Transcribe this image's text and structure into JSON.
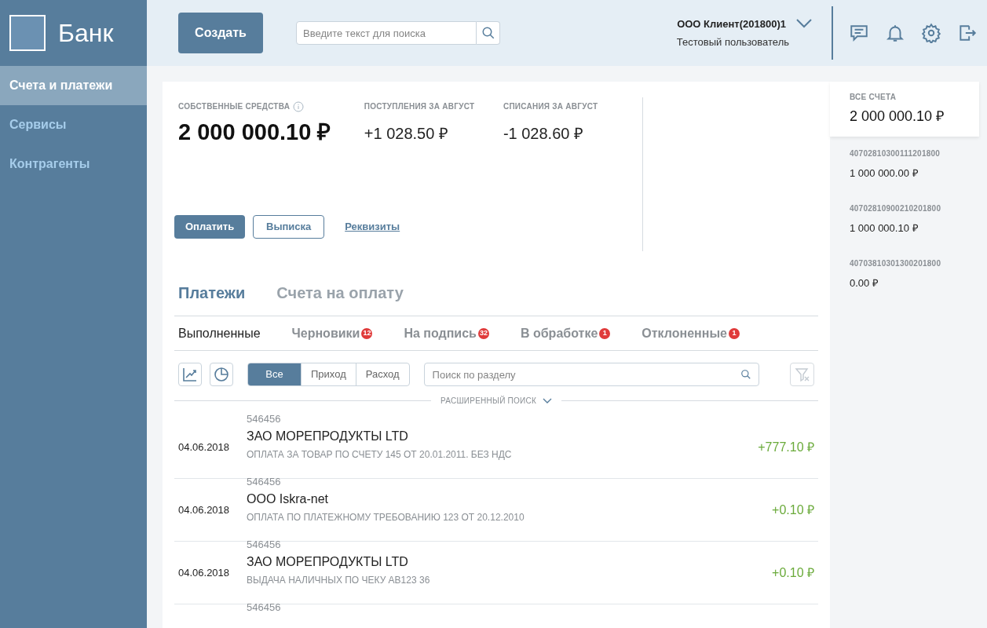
{
  "logo": {
    "text": "Банк"
  },
  "sidebar": {
    "items": [
      {
        "label": "Счета и платежи",
        "selected": true
      },
      {
        "label": "Сервисы",
        "selected": false
      },
      {
        "label": "Контрагенты",
        "selected": false
      }
    ]
  },
  "header": {
    "create_button": "Создать",
    "search": {
      "placeholder": "Введите текст для поиска"
    },
    "client": {
      "name": "ООО Клиент(201800)1",
      "user": "Тестовый пользователь"
    }
  },
  "summary": {
    "items": [
      {
        "label": "СОБСТВЕННЫЕ СРЕДСТВА",
        "value": "2 000 000.10 ₽",
        "kind": "main"
      },
      {
        "label": "ПОСТУПЛЕНИЯ ЗА АВГУСТ",
        "value": "+1 028.50 ₽",
        "kind": "plain"
      },
      {
        "label": "СПИСАНИЯ ЗА АВГУСТ",
        "value": "-1 028.60 ₽",
        "kind": "plain"
      }
    ],
    "buttons": {
      "pay": "Оплатить",
      "statement": "Выписка",
      "details": "Реквизиты"
    }
  },
  "tabs": [
    {
      "label": "Платежи",
      "selected": true
    },
    {
      "label": "Счета на оплату",
      "selected": false
    }
  ],
  "subtabs": [
    {
      "label": "Выполненные",
      "selected": true
    },
    {
      "label": "Черновики",
      "badge": "12",
      "selected": false
    },
    {
      "label": "На подпись",
      "badge": "32",
      "selected": false
    },
    {
      "label": "В обработке",
      "badge": "1",
      "selected": false
    },
    {
      "label": "Отклоненные",
      "badge": "1",
      "selected": false
    }
  ],
  "filter": {
    "segments": [
      {
        "label": "Все",
        "selected": true
      },
      {
        "label": "Приход",
        "selected": false
      },
      {
        "label": "Расход",
        "selected": false
      }
    ],
    "search_placeholder": "Поиск по разделу",
    "advanced": "РАСШИРЕННЫЙ ПОИСК"
  },
  "payments": [
    {
      "date": "04.06.2018",
      "code": "546456",
      "name": "ЗАО МОРЕПРОДУКТЫ LTD",
      "purpose": "ОПЛАТА ЗА ТОВАР ПО СЧЕТУ 145 ОТ 20.01.2011. БЕЗ НДС",
      "amount": "+777.10 ₽"
    },
    {
      "date": "04.06.2018",
      "code": "546456",
      "name": "ООО Iskra-net",
      "purpose": "ОПЛАТА ПО ПЛАТЕЖНОМУ ТРЕБОВАНИЮ 123 ОТ 20.12.2010",
      "amount": "+0.10 ₽"
    },
    {
      "date": "04.06.2018",
      "code": "546456",
      "name": "ЗАО МОРЕПРОДУКТЫ LTD",
      "purpose": "ВЫДАЧА НАЛИЧНЫХ ПО ЧЕКУ АВ123 36",
      "amount": "+0.10 ₽"
    },
    {
      "code": "546456"
    }
  ],
  "accounts": {
    "total_label": "ВСЕ СЧЕТА",
    "total": "2 000 000.10 ₽",
    "items": [
      {
        "number": "40702810300111201800",
        "balance": "1 000 000.00 ₽"
      },
      {
        "number": "40702810900210201800",
        "balance": "1 000 000.10 ₽"
      },
      {
        "number": "40703810301300201800",
        "balance": "0.00 ₽"
      }
    ]
  }
}
